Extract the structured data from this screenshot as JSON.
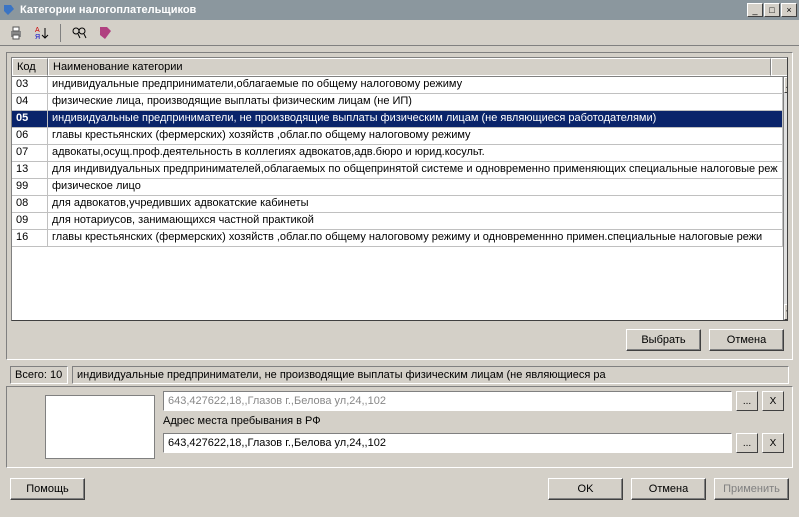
{
  "window": {
    "title": "Категории налогоплательщиков",
    "min_label": "_",
    "max_label": "□",
    "close_label": "×"
  },
  "table": {
    "headers": {
      "code": "Код",
      "name": "Наименование категории"
    },
    "rows": [
      {
        "code": "03",
        "name": "индивидуальные предприниматели,облагаемые по общему налоговому режиму"
      },
      {
        "code": "04",
        "name": "физические лица, производящие выплаты физическим лицам (не ИП)"
      },
      {
        "code": "05",
        "name": "индивидуальные предприниматели, не производящие выплаты физическим лицам (не являющиеся работодателями)"
      },
      {
        "code": "06",
        "name": "главы крестьянских (фермерских) хозяйств ,облаг.по общему налоговому режиму"
      },
      {
        "code": "07",
        "name": "адвокаты,осущ.проф.деятельность в коллегиях адвокатов,адв.бюро и юрид.косульт."
      },
      {
        "code": "13",
        "name": "для индивидуальных предпринимателей,облагаемых по общепринятой системе и одновременно применяющих специальные налоговые реж"
      },
      {
        "code": "99",
        "name": "физическое лицо"
      },
      {
        "code": "08",
        "name": "для адвокатов,учредивших адвокатские кабинеты"
      },
      {
        "code": "09",
        "name": "для нотариусов, занимающихся частной практикой"
      },
      {
        "code": "16",
        "name": "главы крестьянских (фермерских) хозяйств ,облаг.по общему налоговому режиму и одновременнно примен.специальные налоговые режи"
      }
    ],
    "selected_index": 2
  },
  "buttons": {
    "select": "Выбрать",
    "cancel": "Отмена",
    "help": "Помощь",
    "ok": "OK",
    "apply": "Применить"
  },
  "status": {
    "total_label": "Всего: 10",
    "detail": "индивидуальные предприниматели, не производящие выплаты физическим лицам (не являющиеся ра"
  },
  "form": {
    "partial_value": "643,427622,18,,Глазов г.,Белова ул,24,,102",
    "address_label": "Адрес места пребывания в РФ",
    "address_value": "643,427622,18,,Глазов г.,Белова ул,24,,102",
    "dots": "...",
    "x": "X"
  },
  "scroll": {
    "up": "▲",
    "down": "▼"
  }
}
